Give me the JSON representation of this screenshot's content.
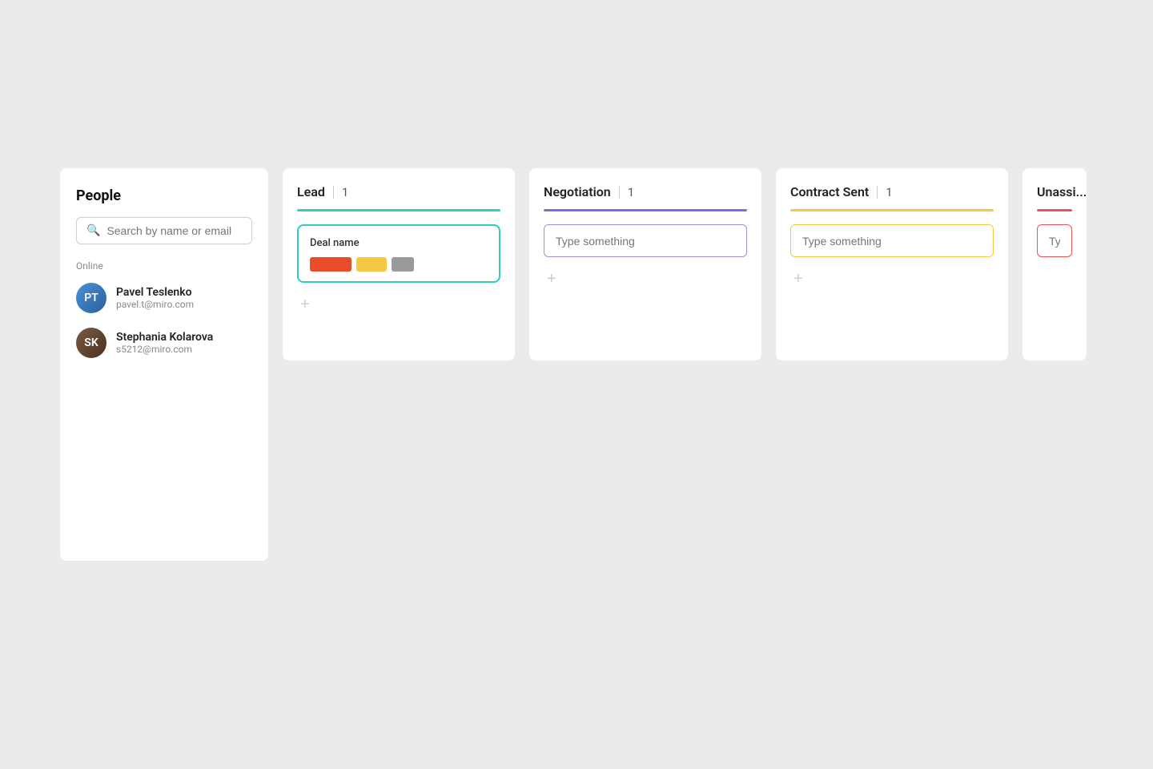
{
  "people_panel": {
    "title": "People",
    "search_placeholder": "Search by name or email",
    "online_label": "Online",
    "users": [
      {
        "name": "Pavel Teslenko",
        "email": "pavel.t@miro.com",
        "initials": "PT",
        "avatar_class": "avatar-pavel"
      },
      {
        "name": "Stephania Kolarova",
        "email": "s5212@miro.com",
        "initials": "SK",
        "avatar_class": "avatar-stephania"
      }
    ]
  },
  "kanban": {
    "columns": [
      {
        "id": "lead",
        "title": "Lead",
        "count": "1",
        "line_class": "line-green",
        "type": "with-deal"
      },
      {
        "id": "negotiation",
        "title": "Negotiation",
        "count": "1",
        "line_class": "line-purple",
        "type": "type-input",
        "input_placeholder": "Type something",
        "input_border_class": "type-input-card-purple"
      },
      {
        "id": "contract-sent",
        "title": "Contract Sent",
        "count": "1",
        "line_class": "line-yellow",
        "type": "type-input",
        "input_placeholder": "Type something",
        "input_border_class": "type-input-card-yellow"
      },
      {
        "id": "unassigned",
        "title": "Unassi...",
        "count": "",
        "line_class": "line-red",
        "type": "type-input-partial",
        "input_placeholder": "Type s...",
        "input_border_class": "type-input-card-red"
      }
    ],
    "deal": {
      "name": "Deal name",
      "tags": [
        {
          "color": "tag-red"
        },
        {
          "color": "tag-yellow"
        },
        {
          "color": "tag-gray"
        }
      ]
    },
    "add_label": "+",
    "type_something": "Type something"
  }
}
